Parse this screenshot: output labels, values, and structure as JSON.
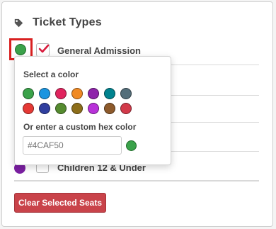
{
  "section": {
    "title": "Ticket Types",
    "icon": "tag-icon"
  },
  "ticket_types": [
    {
      "label": "General Admission",
      "color": "#3aa24a",
      "checked": true
    },
    {
      "label": "Children 12 & Under",
      "color": "#7b1fa2",
      "checked": false
    }
  ],
  "hidden_row_swatch_colors": [
    "#1e6fd0",
    "#2e7d32",
    "#3a3a8a"
  ],
  "color_picker": {
    "heading": "Select a color",
    "palette": [
      "#3aa24a",
      "#1a95e0",
      "#e0245e",
      "#f08a24",
      "#8e24aa",
      "#00838f",
      "#546e7a",
      "#e53935",
      "#303f9f",
      "#558b2f",
      "#8d6e1a",
      "#b832d9",
      "#8d5a2b",
      "#d23a4a"
    ],
    "custom_heading": "Or enter a custom hex color",
    "custom_value": "#4CAF50",
    "preview_color": "#3aa24a"
  },
  "actions": {
    "clear_label": "Clear Selected Seats"
  }
}
